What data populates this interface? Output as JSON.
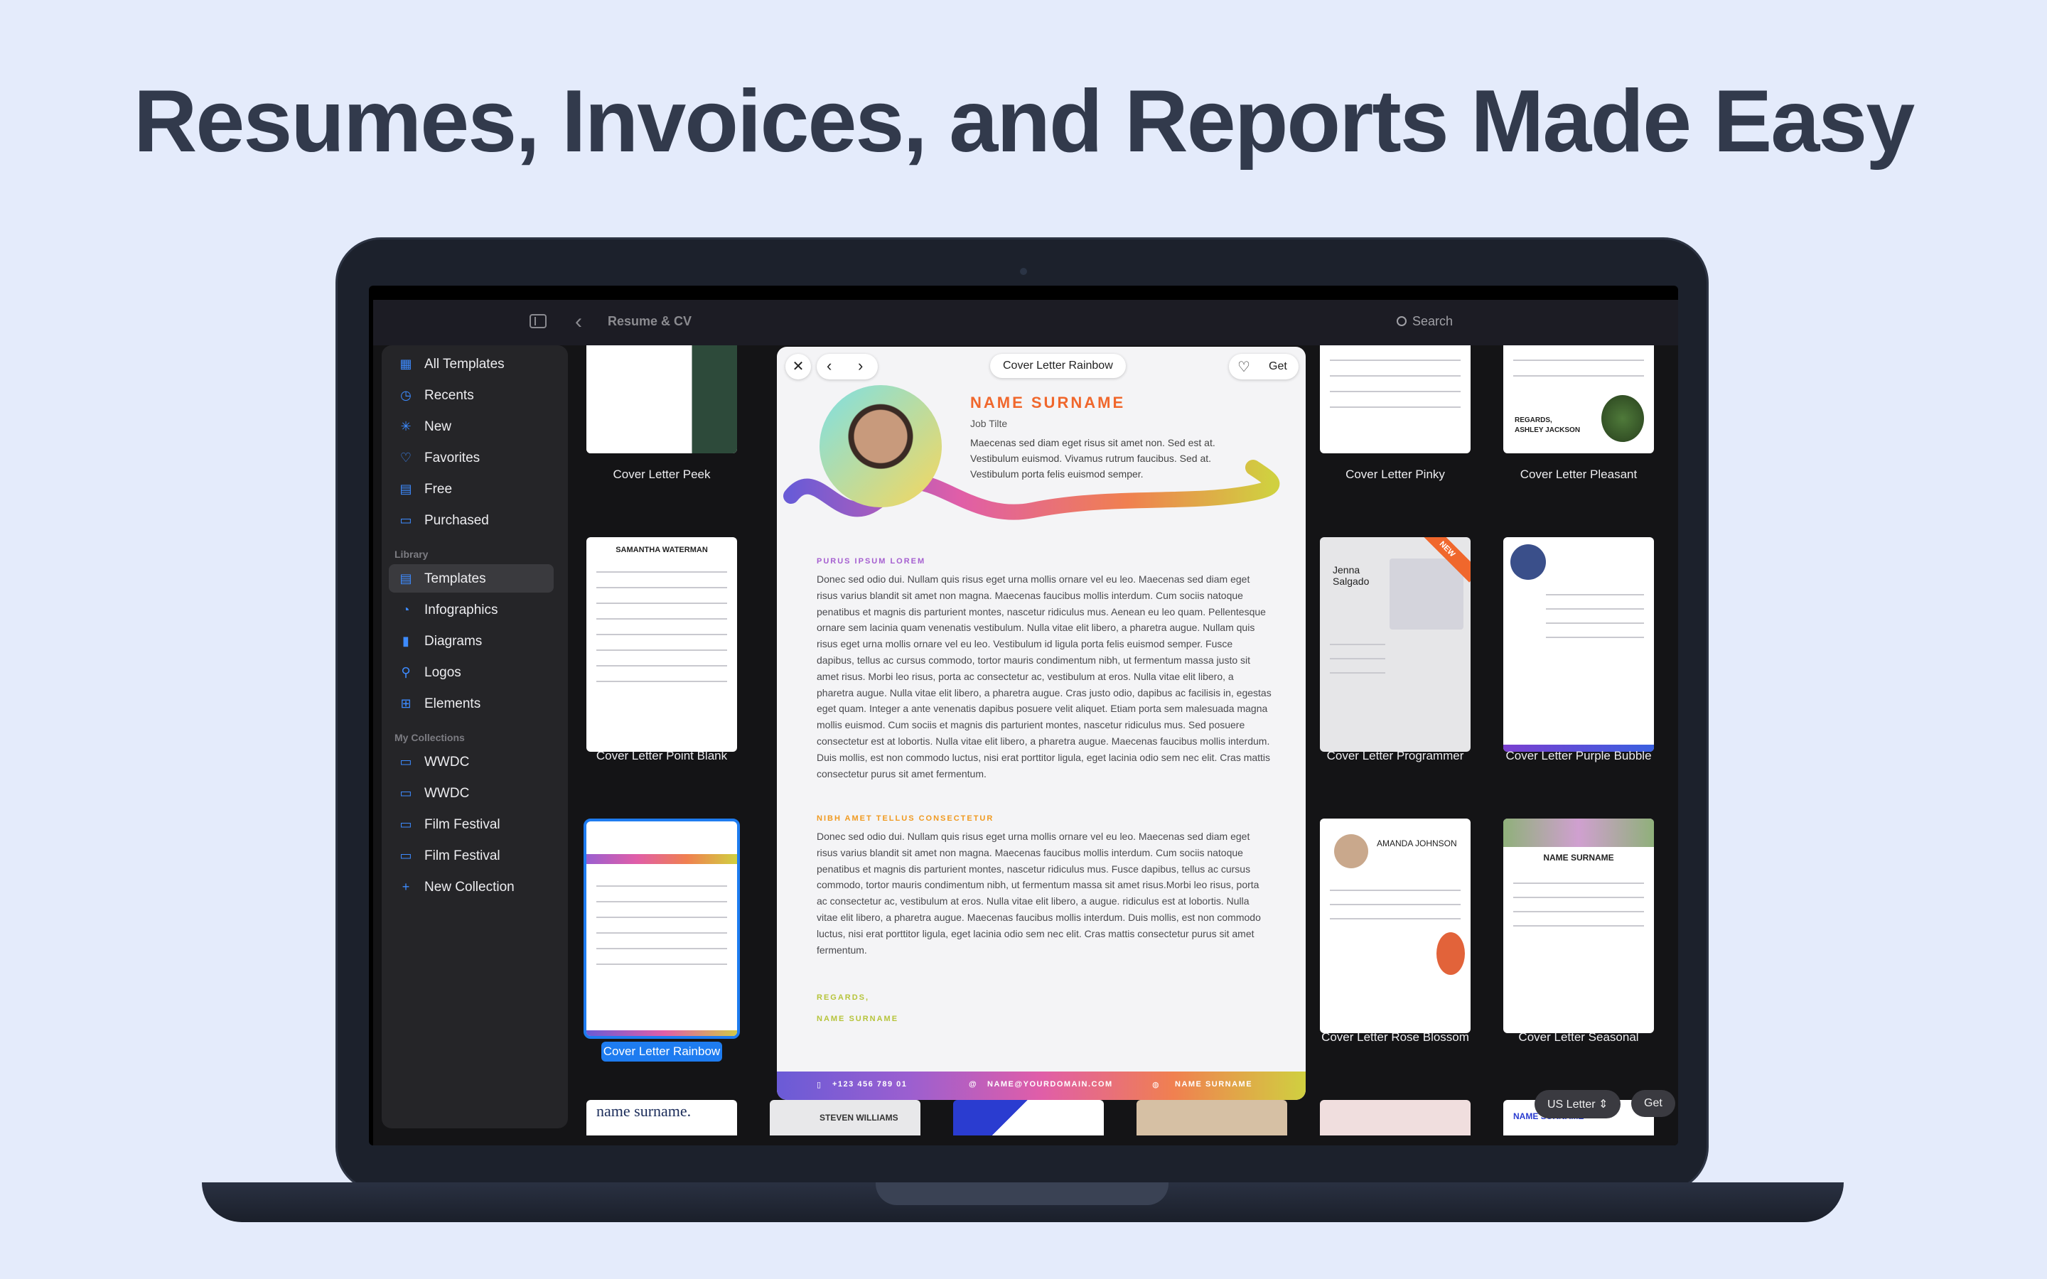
{
  "headline": "Resumes, Invoices, and Reports Made Easy",
  "titlebar": {
    "breadcrumb": "Resume & CV",
    "search_label": "Search"
  },
  "sidebar": {
    "items": [
      {
        "label": "All Templates",
        "icon": "grid-icon"
      },
      {
        "label": "Recents",
        "icon": "clock-icon"
      },
      {
        "label": "New",
        "icon": "sparkle-icon"
      },
      {
        "label": "Favorites",
        "icon": "heart-icon"
      },
      {
        "label": "Free",
        "icon": "calendar-icon"
      },
      {
        "label": "Purchased",
        "icon": "bag-icon"
      }
    ],
    "library_heading": "Library",
    "library": [
      {
        "label": "Templates",
        "icon": "document-icon",
        "active": true
      },
      {
        "label": "Infographics",
        "icon": "chart-circle-icon"
      },
      {
        "label": "Diagrams",
        "icon": "bar-chart-icon"
      },
      {
        "label": "Logos",
        "icon": "pin-icon"
      },
      {
        "label": "Elements",
        "icon": "squares-icon"
      }
    ],
    "collections_heading": "My Collections",
    "collections": [
      {
        "label": "WWDC"
      },
      {
        "label": "WWDC"
      },
      {
        "label": "Film Festival"
      },
      {
        "label": "Film Festival"
      }
    ],
    "new_collection": "New Collection"
  },
  "thumbs": {
    "peek": "Cover Letter Peek",
    "point_blank": "Cover Letter Point Blank",
    "rainbow": "Cover Letter Rainbow",
    "pinky": "Cover Letter Pinky",
    "pleasant": "Cover Letter Pleasant",
    "programmer": "Cover Letter Programmer",
    "purple_bubble": "Cover Letter Purple Bubble",
    "rose_blossom": "Cover Letter Rose Blossom",
    "seasonal": "Cover Letter Seasonal",
    "point_blank_name": "SAMANTHA WATERMAN",
    "pleasant_regards": "REGARDS,",
    "pleasant_name": "ASHLEY JACKSON",
    "programmer_name": "Jenna Salgado",
    "programmer_badge": "NEW",
    "rose_name": "AMANDA JOHNSON",
    "seasonal_name": "NAME SURNAME",
    "bottom1": "name surname.",
    "bottom2": "STEVEN WILLIAMS",
    "bottom3": "NAME SURNAME"
  },
  "preview": {
    "title": "Cover Letter Rainbow",
    "get_label": "Get",
    "name": "NAME SURNAME",
    "job_title": "Job Tilte",
    "intro": "Maecenas sed diam eget risus sit amet non. Sed est at. Vestibulum euismod. Vivamus rutrum faucibus. Sed at. Vestibulum porta felis euismod semper.",
    "section1_heading": "PURUS IPSUM LOREM",
    "section1_body": "Donec sed odio dui. Nullam quis risus eget urna mollis ornare vel eu leo. Maecenas sed diam eget risus varius blandit sit amet non magna. Maecenas faucibus mollis interdum. Cum sociis natoque penatibus et magnis dis parturient montes, nascetur ridiculus mus. Aenean eu leo quam. Pellentesque ornare sem lacinia quam venenatis vestibulum. Nulla vitae elit libero, a pharetra augue. Nullam quis risus eget urna mollis ornare vel eu leo. Vestibulum id ligula porta felis euismod semper. Fusce dapibus, tellus ac cursus commodo, tortor mauris condimentum nibh, ut fermentum massa justo sit amet risus. Morbi leo risus, porta ac consectetur ac, vestibulum at eros. Nulla vitae elit libero, a pharetra augue. Nulla vitae elit libero, a pharetra augue. Cras justo odio, dapibus ac facilisis in, egestas eget quam. Integer a ante venenatis dapibus posuere velit aliquet. Etiam porta sem malesuada magna mollis euismod. Cum sociis et magnis dis parturient montes, nascetur ridiculus mus. Sed posuere consectetur est at lobortis. Nulla vitae elit libero, a pharetra augue. Maecenas faucibus mollis interdum. Duis mollis, est non commodo luctus, nisi erat porttitor ligula, eget lacinia odio sem nec elit. Cras mattis consectetur purus sit amet fermentum.",
    "section2_heading": "NIBH AMET TELLUS CONSECTETUR",
    "section2_body": "Donec sed odio dui. Nullam quis risus eget urna mollis ornare vel eu leo. Maecenas sed diam eget risus varius blandit sit amet non magna. Maecenas faucibus mollis interdum. Cum sociis natoque penatibus et magnis dis parturient montes, nascetur ridiculus mus. Fusce dapibus, tellus ac cursus commodo, tortor mauris condimentum nibh, ut fermentum massa sit amet risus.Morbi leo risus, porta ac consectetur ac, vestibulum at eros. Nulla vitae elit libero, a augue. ridiculus est at lobortis. Nulla vitae elit libero, a pharetra augue. Maecenas faucibus mollis interdum. Duis mollis, est non commodo luctus, nisi erat porttitor ligula, eget lacinia odio sem nec elit. Cras mattis consectetur purus sit amet fermentum.",
    "regards": "REGARDS,",
    "signature": "NAME SURNAME",
    "footer_phone": "+123 456 789 01",
    "footer_email": "NAME@YOURDOMAIN.COM",
    "footer_web": "NAME SURNAME"
  },
  "bottom_controls": {
    "paper_size": "US Letter",
    "get_label": "Get"
  },
  "colors": {
    "accent": "#1e7cf0",
    "background": "#e4ebfb",
    "name_orange": "#f0672c",
    "section_purple": "#a55fd0",
    "section_orange": "#f09a20",
    "regards_green": "#b6c43a"
  }
}
